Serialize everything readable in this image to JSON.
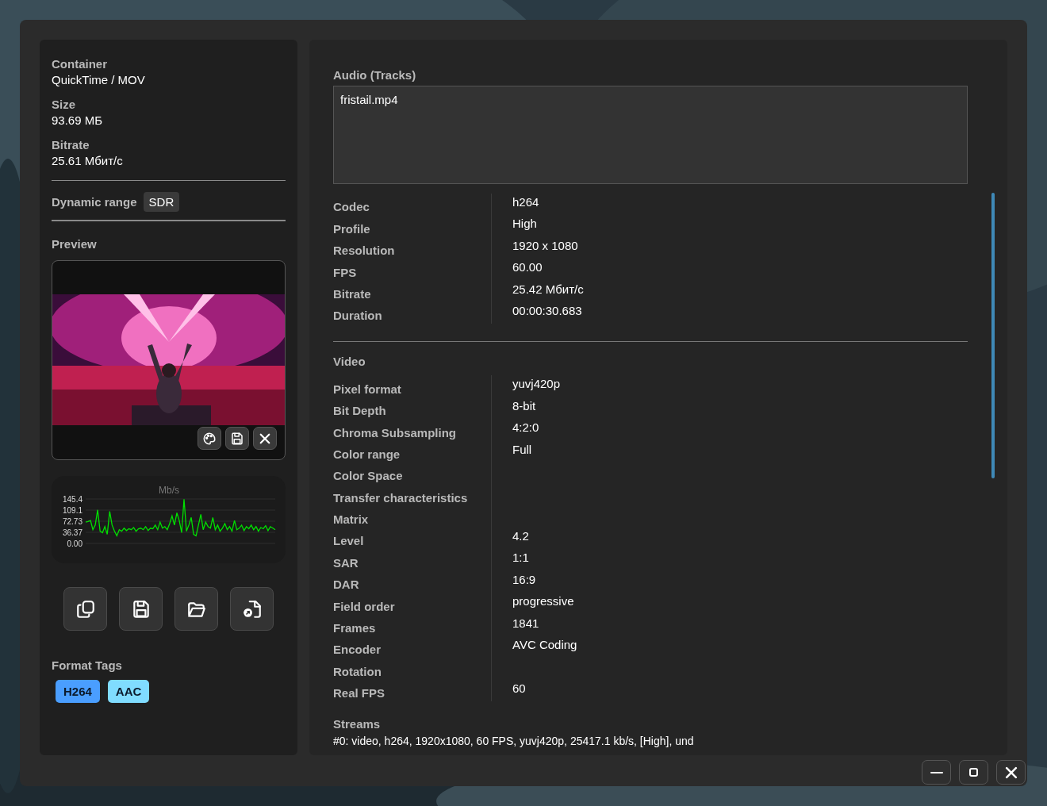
{
  "left": {
    "info": [
      {
        "label": "Container",
        "value": "QuickTime / MOV"
      },
      {
        "label": "Size",
        "value": "93.69 МБ"
      },
      {
        "label": "Bitrate",
        "value": "25.61 Мбит/с"
      }
    ],
    "dynamic_range": {
      "label": "Dynamic range",
      "value": "SDR"
    },
    "preview": {
      "label": "Preview",
      "overlay_buttons": [
        {
          "kind": "palette"
        },
        {
          "kind": "save"
        },
        {
          "kind": "close"
        }
      ]
    },
    "bitrate_chart": {
      "chart_data": {
        "type": "line",
        "title": "Mb/s",
        "ylim": [
          0,
          145.47
        ],
        "grid": true,
        "yticks": [
          145.4,
          109.1,
          72.73,
          36.37,
          {
            "value": 0,
            "label": "0.00"
          }
        ],
        "series": [
          {
            "color": "#00e000",
            "values": [
              70,
              72,
              75,
              45,
              60,
              110,
              40,
              35,
              55,
              30,
              105,
              60,
              40,
              25,
              45,
              40,
              50,
              42,
              48,
              45,
              52,
              40,
              48,
              50,
              45,
              55,
              42,
              50,
              48,
              60,
              45,
              70,
              50,
              55,
              45,
              65,
              90,
              60,
              100,
              75,
              35,
              145,
              40,
              60,
              85,
              30,
              25,
              60,
              95,
              45,
              70,
              55,
              50,
              85,
              45,
              60,
              40,
              50,
              65,
              45,
              55,
              40,
              75,
              45,
              50,
              60,
              42,
              55,
              48,
              60,
              45,
              55,
              40,
              52,
              48,
              58,
              42,
              55,
              50,
              45
            ]
          }
        ]
      }
    },
    "actions": [
      {
        "kind": "copy"
      },
      {
        "kind": "save"
      },
      {
        "kind": "folder"
      },
      {
        "kind": "export"
      }
    ],
    "format_tags": {
      "label": "Format Tags",
      "tags": [
        {
          "text": "H264",
          "color": "#4a9eff"
        },
        {
          "text": "AAC",
          "color": "#80dcff"
        }
      ]
    }
  },
  "audio": {
    "label": "Audio (Tracks)",
    "tracks": [
      "fristail.mp4"
    ]
  },
  "general": [
    {
      "label": "Codec",
      "value": "h264"
    },
    {
      "label": "Profile",
      "value": "High"
    },
    {
      "label": "Resolution",
      "value": "1920 x 1080"
    },
    {
      "label": "FPS",
      "value": "60.00"
    },
    {
      "label": "Bitrate",
      "value": "25.42 Мбит/с"
    },
    {
      "label": "Duration",
      "value": "00:00:30.683"
    }
  ],
  "video": {
    "title": "Video",
    "fields": [
      {
        "label": "Pixel format",
        "value": "yuvj420p"
      },
      {
        "label": "Bit Depth",
        "value": "8-bit"
      },
      {
        "label": "Chroma Subsampling",
        "value": "4:2:0"
      },
      {
        "label": "Color range",
        "value": "Full"
      },
      {
        "label": "Color Space"
      },
      {
        "label": "Transfer characteristics"
      },
      {
        "label": "Matrix"
      },
      {
        "label": "Level",
        "value": "4.2"
      },
      {
        "label": "SAR",
        "value": "1:1"
      },
      {
        "label": "DAR",
        "value": "16:9"
      },
      {
        "label": "Field order",
        "value": "progressive"
      },
      {
        "label": "Frames",
        "value": "1841"
      },
      {
        "label": "Encoder",
        "value": "AVC Coding"
      },
      {
        "label": "Rotation"
      },
      {
        "label": "Real FPS",
        "value": "60"
      }
    ]
  },
  "streams": {
    "title": "Streams",
    "lines": [
      "#0: video, h264, 1920x1080, 60 FPS, yuvj420p, 25417.1 kb/s, [High], und"
    ]
  },
  "window_controls": [
    {
      "kind": "minimize"
    },
    {
      "kind": "maximize"
    },
    {
      "kind": "close"
    }
  ]
}
